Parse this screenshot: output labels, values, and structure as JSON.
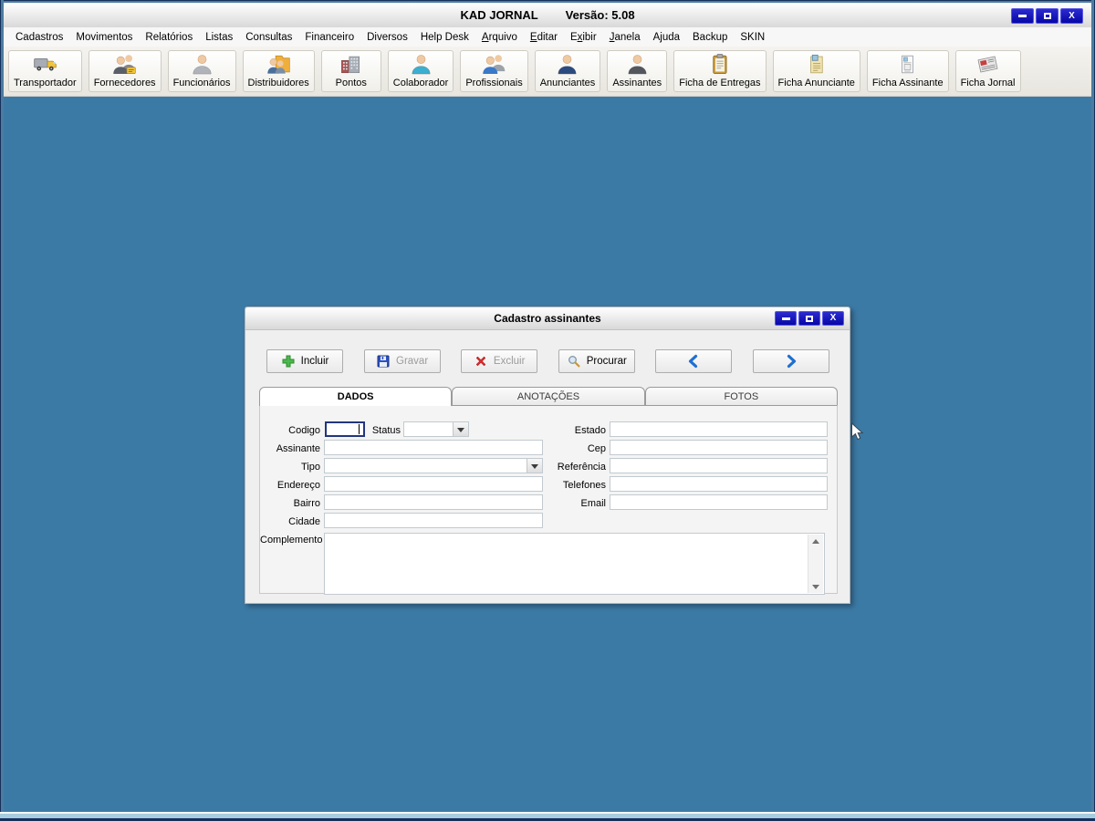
{
  "window": {
    "title": "KAD JORNAL",
    "version": "Versão: 5.08",
    "controls": [
      "minimize-icon",
      "maximize-icon",
      "close-icon"
    ]
  },
  "menubar": {
    "items": [
      {
        "label": "Cadastros",
        "underline_index": -1
      },
      {
        "label": "Movimentos",
        "underline_index": -1
      },
      {
        "label": "Relatórios",
        "underline_index": -1
      },
      {
        "label": "Listas",
        "underline_index": -1
      },
      {
        "label": "Consultas",
        "underline_index": -1
      },
      {
        "label": "Financeiro",
        "underline_index": -1
      },
      {
        "label": "Diversos",
        "underline_index": -1
      },
      {
        "label": "Help Desk",
        "underline_index": -1
      },
      {
        "label": "Arquivo",
        "underline_index": 0
      },
      {
        "label": "Editar",
        "underline_index": 0
      },
      {
        "label": "Exibir",
        "underline_index": 1
      },
      {
        "label": "Janela",
        "underline_index": 0
      },
      {
        "label": "Ajuda",
        "underline_index": -1
      },
      {
        "label": "Backup",
        "underline_index": -1
      },
      {
        "label": "SKIN",
        "underline_index": -1
      }
    ]
  },
  "toolbar": {
    "buttons": [
      {
        "label": "Transportador",
        "icon": "truck-icon"
      },
      {
        "label": "Fornecedores",
        "icon": "suppliers-icon"
      },
      {
        "label": "Funcionários",
        "icon": "employee-icon"
      },
      {
        "label": "Distribuidores",
        "icon": "distributors-icon"
      },
      {
        "label": "Pontos",
        "icon": "buildings-icon"
      },
      {
        "label": "Colaborador",
        "icon": "collaborator-icon"
      },
      {
        "label": "Profissionais",
        "icon": "professionals-icon"
      },
      {
        "label": "Anunciantes",
        "icon": "advertiser-icon"
      },
      {
        "label": "Assinantes",
        "icon": "subscriber-icon"
      },
      {
        "label": "Ficha de Entregas",
        "icon": "delivery-sheet-icon"
      },
      {
        "label": "Ficha Anunciante",
        "icon": "advertiser-sheet-icon"
      },
      {
        "label": "Ficha Assinante",
        "icon": "subscriber-sheet-icon"
      },
      {
        "label": "Ficha Jornal",
        "icon": "journal-sheet-icon"
      }
    ]
  },
  "dialog": {
    "title": "Cadastro assinantes",
    "controls": [
      "minimize-icon",
      "maximize-icon",
      "close-icon"
    ],
    "actions": [
      {
        "name": "incluir-button",
        "label": "Incluir",
        "icon": "plus-icon",
        "enabled": true
      },
      {
        "name": "gravar-button",
        "label": "Gravar",
        "icon": "save-icon",
        "enabled": false
      },
      {
        "name": "excluir-button",
        "label": "Excluir",
        "icon": "delete-icon",
        "enabled": false
      },
      {
        "name": "procurar-button",
        "label": "Procurar",
        "icon": "search-icon",
        "enabled": true
      },
      {
        "name": "previous-button",
        "label": "",
        "icon": "prev-icon",
        "enabled": true
      },
      {
        "name": "next-button",
        "label": "",
        "icon": "next-icon",
        "enabled": true
      }
    ],
    "tabs": [
      {
        "label": "DADOS",
        "active": true
      },
      {
        "label": "ANOTAÇÕES",
        "active": false
      },
      {
        "label": "FOTOS",
        "active": false
      }
    ],
    "form": {
      "labels": {
        "codigo": "Codigo",
        "status": "Status",
        "assinante": "Assinante",
        "tipo": "Tipo",
        "endereco": "Endereço",
        "bairro": "Bairro",
        "cidade": "Cidade",
        "complemento": "Complemento",
        "estado": "Estado",
        "cep": "Cep",
        "referencia": "Referência",
        "telefones": "Telefones",
        "email": "Email"
      },
      "values": {
        "codigo": "",
        "status": "",
        "assinante": "",
        "tipo": "",
        "endereco": "",
        "bairro": "",
        "cidade": "",
        "complemento": "",
        "estado": "",
        "cep": "",
        "referencia": "",
        "telefones": "",
        "email": ""
      }
    }
  },
  "colors": {
    "mdi_background": "#3C7AA6",
    "titlebar_button": "#0B0BB2",
    "disabled_text": "#9B9B9B",
    "focus_border": "#23357E"
  }
}
